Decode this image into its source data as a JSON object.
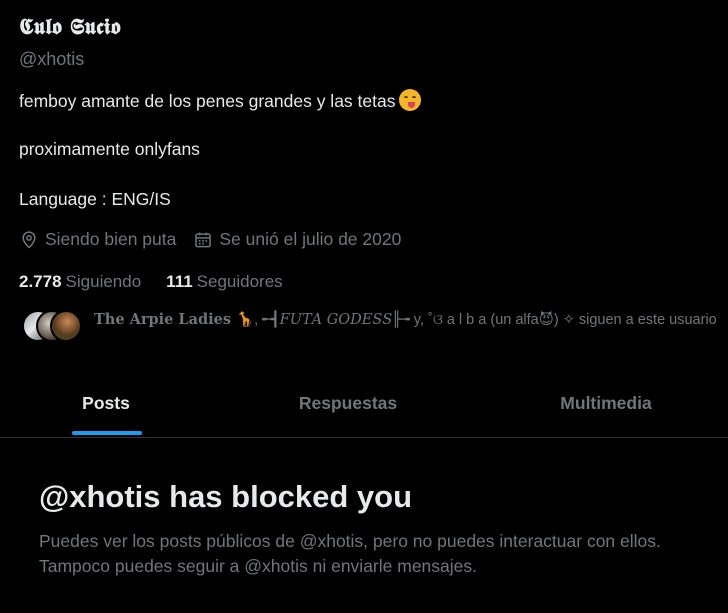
{
  "profile": {
    "display_name": "𝕮𝖚𝖑𝖔 𝕾𝖚𝖈𝖎𝖔",
    "handle": "@xhotis",
    "bio_line1": "femboy amante de los penes grandes y las tetas",
    "bio_line1_emoji": "face-savoring-food-emoji",
    "bio_line2": "proximamente onlyfans",
    "bio_line3": "Language : ENG/IS",
    "location": "Siendo bien puta",
    "joined": "Se unió el julio de 2020",
    "following_count": "2.778",
    "following_label": "Siguiendo",
    "followers_count": "111",
    "followers_label": "Seguidores",
    "followed_by": {
      "name1": "𝐓𝐡𝐞 𝐀𝐫𝐩𝐢𝐞 𝐋𝐚𝐝𝐢𝐞𝐬 🦒",
      "sep1": ",",
      "name2": "╾┫𝐹𝑈𝑇𝐴 𝐺𝑂𝐷𝐸𝑆𝑆╟╼",
      "and": "y",
      "name3": ", ˚ଓ a l b a (un alfa😈) ✧",
      "suffix": "siguen a este usuario"
    }
  },
  "tabs": [
    {
      "label": "Posts",
      "active": true
    },
    {
      "label": "Respuestas",
      "active": false
    },
    {
      "label": "Multimedia",
      "active": false
    }
  ],
  "blocked": {
    "title": "@xhotis has blocked you",
    "message": "Puedes ver los posts públicos de @xhotis, pero no puedes interactuar con ellos. Tampoco puedes seguir a @xhotis ni enviarle mensajes."
  },
  "colors": {
    "background": "#000000",
    "text_primary": "#e7e9ea",
    "text_secondary": "#71767b",
    "accent": "#1d9bf0",
    "divider": "#2f3336"
  }
}
